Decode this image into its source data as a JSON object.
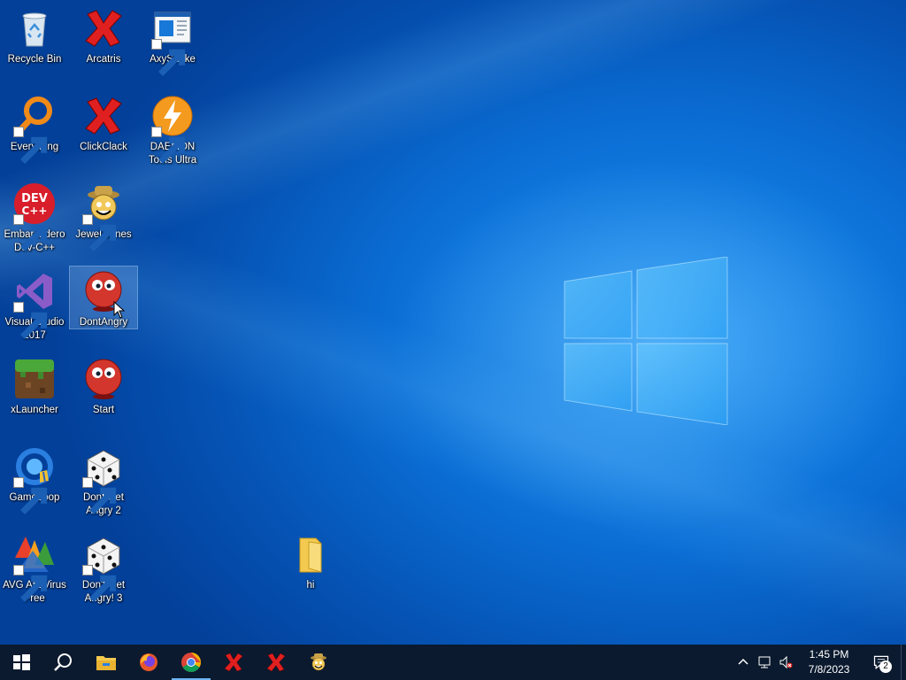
{
  "desktop": {
    "icons": [
      {
        "label": "Recycle Bin",
        "icon": "recycle-bin-icon",
        "shortcut": false
      },
      {
        "label": "Arcatris",
        "icon": "red-x-icon",
        "shortcut": false
      },
      {
        "label": "AxySnake",
        "icon": "window-app-icon",
        "shortcut": true
      },
      {
        "label": "Everything",
        "icon": "magnifier-orange-icon",
        "shortcut": true
      },
      {
        "label": "ClickClack",
        "icon": "red-x-icon",
        "shortcut": false
      },
      {
        "label": "DAEMON\nTools Ultra",
        "icon": "lightning-orange-icon",
        "shortcut": true
      },
      {
        "label": "Embarcadero\nDev-C++",
        "icon": "devcpp-icon",
        "shortcut": true
      },
      {
        "label": "Jewel Jones",
        "icon": "jewel-jones-icon",
        "shortcut": true
      },
      {
        "label": "Visual Studio\n2017",
        "icon": "visual-studio-icon",
        "shortcut": true
      },
      {
        "label": "DontAngry",
        "icon": "red-ball-face-icon",
        "shortcut": false
      },
      {
        "label": "xLauncher",
        "icon": "minecraft-block-icon",
        "shortcut": false
      },
      {
        "label": "Start",
        "icon": "red-ball-face-icon",
        "shortcut": false
      },
      {
        "label": "GameLoop",
        "icon": "gameloop-icon",
        "shortcut": true
      },
      {
        "label": "Dont Get\nAngry 2",
        "icon": "dice-icon",
        "shortcut": true
      },
      {
        "label": "AVG AntiVirus\nFree",
        "icon": "avg-icon",
        "shortcut": true
      },
      {
        "label": "Don't Get\nAngry! 3",
        "icon": "dice-icon",
        "shortcut": true
      },
      {
        "label": "hi",
        "icon": "folder-icon",
        "shortcut": false
      }
    ]
  },
  "taskbar": {
    "pinned": [
      {
        "name": "start-button",
        "icon": "windows-logo-icon"
      },
      {
        "name": "search-button",
        "icon": "search-icon"
      },
      {
        "name": "file-explorer-button",
        "icon": "folder-icon"
      },
      {
        "name": "firefox-button",
        "icon": "firefox-icon"
      },
      {
        "name": "chrome-button",
        "icon": "chrome-icon"
      },
      {
        "name": "arcatris-task-button",
        "icon": "red-x-icon"
      },
      {
        "name": "clickclack-task-button",
        "icon": "red-x-icon"
      },
      {
        "name": "jewel-jones-task-button",
        "icon": "jewel-jones-icon"
      }
    ],
    "clock": {
      "time": "1:45 PM",
      "date": "7/8/2023"
    },
    "notifications_count": "2",
    "colors": {
      "taskbar": "#0b1a2e",
      "active_indicator": "#6cb4f5"
    }
  }
}
